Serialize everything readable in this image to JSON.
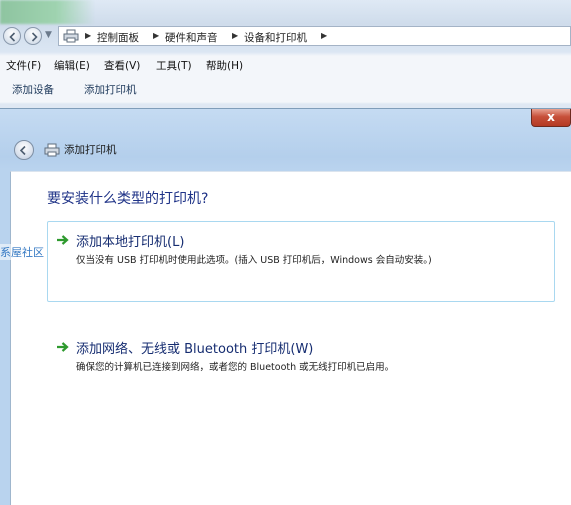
{
  "explorer": {
    "breadcrumbs": [
      "控制面板",
      "硬件和声音",
      "设备和打印机"
    ],
    "menu": [
      "文件(F)",
      "编辑(E)",
      "查看(V)",
      "工具(T)",
      "帮助(H)"
    ],
    "toolbar": [
      "添加设备",
      "添加打印机"
    ]
  },
  "dialog": {
    "title": "添加打印机",
    "close_label": "x",
    "heading": "要安装什么类型的打印机?",
    "options": [
      {
        "title": "添加本地打印机(L)",
        "description": "仅当没有 USB 打印机时使用此选项。(插入 USB 打印机后，Windows 会自动安装。)",
        "selected": true
      },
      {
        "title": "添加网络、无线或 Bluetooth 打印机(W)",
        "description": "确保您的计算机已连接到网络，或者您的 Bluetooth 或无线打印机已启用。",
        "selected": false
      }
    ]
  },
  "watermark": "系屋社区",
  "colors": {
    "heading": "#1e3287",
    "option_title": "#162d71",
    "arrow_green": "#2e9a2e",
    "selected_border": "#a9d8f0",
    "close_red": "#c7503a"
  }
}
